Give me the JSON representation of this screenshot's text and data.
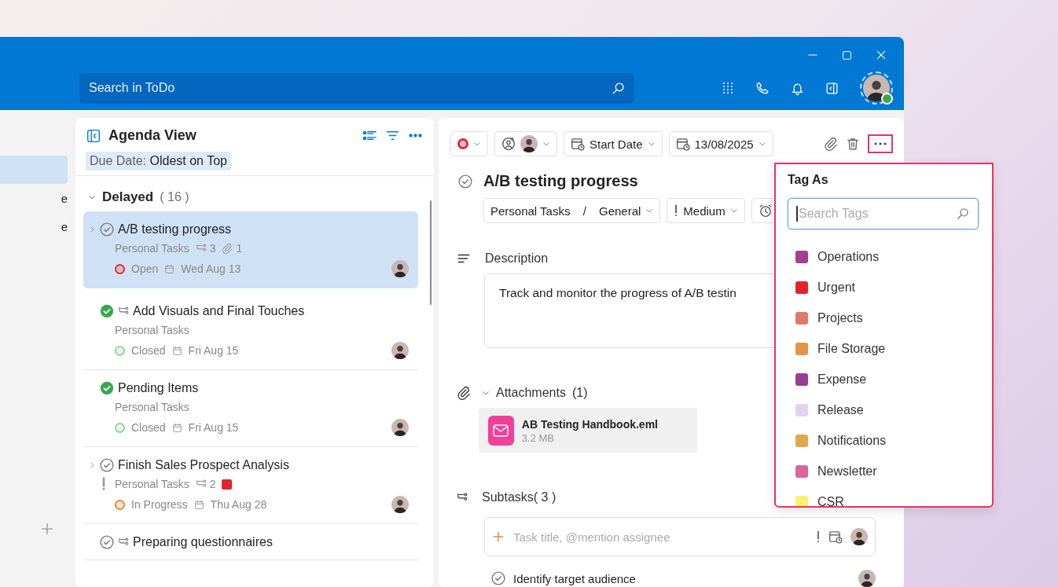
{
  "search": {
    "placeholder": "Search in ToDo"
  },
  "sidebar": {
    "items": [
      {
        "selected": true
      },
      {
        "label": "e",
        "selected": false
      },
      {
        "label": "e",
        "selected": false
      }
    ]
  },
  "agenda": {
    "title": "Agenda View",
    "sort": {
      "label": "Due Date:",
      "value": "Oldest on Top"
    },
    "group": {
      "title": "Delayed",
      "count": "( 16 )",
      "expanded": true
    },
    "tasks": [
      {
        "title": "A/B testing progress",
        "selected": true,
        "expandable": true,
        "done": false,
        "is_subtask": false,
        "important": false,
        "list": "Personal Tasks",
        "subtasks": "3",
        "attachments": "1",
        "status": {
          "label": "Open",
          "color": "#e02b2b"
        },
        "due": "Wed Aug 13"
      },
      {
        "title": "Add Visuals and Final Touches",
        "selected": false,
        "expandable": false,
        "done": true,
        "is_subtask": true,
        "important": false,
        "list": "Personal Tasks",
        "status": {
          "label": "Closed",
          "color": "#8fd3a0"
        },
        "due": "Fri Aug 15"
      },
      {
        "title": "Pending Items",
        "selected": false,
        "expandable": false,
        "done": true,
        "is_subtask": false,
        "important": false,
        "list": "Personal Tasks",
        "status": {
          "label": "Closed",
          "color": "#8fd3a0"
        },
        "due": "Fri Aug 15"
      },
      {
        "title": "Finish Sales Prospect Analysis",
        "selected": false,
        "expandable": true,
        "done": false,
        "is_subtask": false,
        "important": true,
        "list": "Personal Tasks",
        "subtasks": "2",
        "tag": {
          "color": "#e0242c"
        },
        "status": {
          "label": "In Progress",
          "color": "#e8892f"
        },
        "due": "Thu Aug 28"
      },
      {
        "title": "Preparing questionnaires",
        "selected": false,
        "expandable": false,
        "done": false,
        "is_subtask": true
      }
    ]
  },
  "detail": {
    "status": {
      "color": "#e02b2b"
    },
    "start_date": "Start Date",
    "due_date": "13/08/2025",
    "title": "A/B testing progress",
    "done": false,
    "list": "Personal Tasks",
    "separator": "/",
    "folder": "General",
    "priority": "Medium",
    "description_label": "Description",
    "description": "Track and monitor the progress of A/B testin",
    "attachments": {
      "label": "Attachments",
      "count": "(1)",
      "expanded": true,
      "files": [
        {
          "name": "AB Testing Handbook.eml",
          "size": "3.2 MB"
        }
      ]
    },
    "subtasks": {
      "label": "Subtasks( 3 )",
      "placeholder": "Task title, @mention assignee",
      "items": [
        {
          "title": "Identify target audience",
          "done": false
        }
      ]
    }
  },
  "tag_menu": {
    "title": "Tag As",
    "search": {
      "placeholder": "Search Tags",
      "focused": true
    },
    "tags": [
      {
        "label": "Operations",
        "color": "#a0408f"
      },
      {
        "label": "Urgent",
        "color": "#e0242c"
      },
      {
        "label": "Projects",
        "color": "#e07a68"
      },
      {
        "label": "File Storage",
        "color": "#e0954a"
      },
      {
        "label": "Expense",
        "color": "#9b3d94"
      },
      {
        "label": "Release",
        "color": "#e3d3ee"
      },
      {
        "label": "Notifications",
        "color": "#dda94a"
      },
      {
        "label": "Newsletter",
        "color": "#d9679a"
      },
      {
        "label": "CSR",
        "color": "#faf36a"
      }
    ]
  }
}
